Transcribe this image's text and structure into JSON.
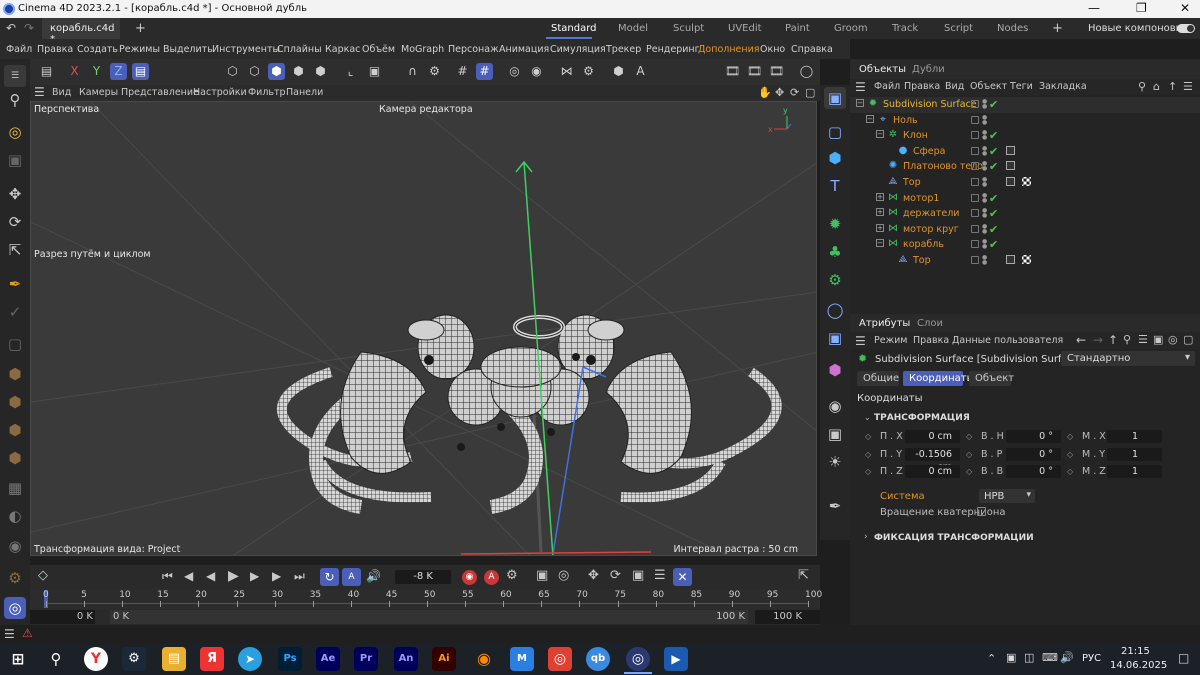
{
  "window": {
    "title": "Cinema 4D 2023.2.1 - [корабль.c4d *] - Основной дубль"
  },
  "doc_tab": {
    "label": "корабль.c4d *",
    "add": "+"
  },
  "layouts": {
    "items": [
      "Standard",
      "Model",
      "Sculpt",
      "UVEdit",
      "Paint",
      "Groom",
      "Track",
      "Script",
      "Nodes"
    ],
    "add": "+",
    "new_layouts": "Новые компоновки"
  },
  "menu": [
    "Файл",
    "Правка",
    "Создать",
    "Режимы",
    "Выделить",
    "Инструменты",
    "Сплайны",
    "Каркас",
    "Объём",
    "MoGraph",
    "Персонаж",
    "Анимация",
    "Симуляция",
    "Трекер",
    "Рендеринг",
    "Дополнения",
    "Окно",
    "Справка"
  ],
  "viewport_menu": [
    "Вид",
    "Камеры",
    "Представление",
    "Настройки",
    "Фильтр",
    "Панели"
  ],
  "viewport": {
    "label": "Перспектива",
    "camera": "Камера редактора",
    "slice_tool": "Разрез путём и циклом",
    "transform_info": "Трансформация вида: Project",
    "grid_info": "Интервал растра : 50 cm"
  },
  "axis_colors": {
    "x": "#e04040",
    "y": "#40d060",
    "z": "#4070e0"
  },
  "objects_panel": {
    "tabs": [
      "Объекты",
      "Дубли"
    ],
    "menu": [
      "Файл",
      "Правка",
      "Вид",
      "Объект",
      "Теги",
      "Закладка"
    ],
    "items": [
      {
        "name": "Subdivision Surface",
        "icon": "subdivision-icon",
        "color": "#e8b830",
        "check": "✔"
      },
      {
        "name": "Ноль",
        "icon": "null-icon",
        "color": "#e1942a",
        "check": ""
      },
      {
        "name": "Клон",
        "icon": "cloner-icon",
        "color": "#e1942a",
        "check": "✔"
      },
      {
        "name": "Сфера",
        "icon": "sphere-icon",
        "color": "#e1942a",
        "check": "✔"
      },
      {
        "name": "Платоново тело",
        "icon": "platonic-icon",
        "color": "#e1942a",
        "check": "✔"
      },
      {
        "name": "Тор",
        "icon": "torus-icon",
        "color": "#e1942a",
        "check": ""
      },
      {
        "name": "мотор1",
        "icon": "symmetry-icon",
        "color": "#e1942a",
        "check": "✔"
      },
      {
        "name": "держатели",
        "icon": "symmetry-icon",
        "color": "#e1942a",
        "check": "✔"
      },
      {
        "name": "мотор круг",
        "icon": "symmetry-icon",
        "color": "#e1942a",
        "check": "✔"
      },
      {
        "name": "корабль",
        "icon": "symmetry-icon",
        "color": "#e1942a",
        "check": "✔"
      },
      {
        "name": "Тор",
        "icon": "torus-icon",
        "color": "#e1942a",
        "check": ""
      }
    ]
  },
  "attributes_panel": {
    "tabs": [
      "Атрибуты",
      "Слои"
    ],
    "menu": [
      "Режим",
      "Правка",
      "Данные пользователя"
    ],
    "object_title": "Subdivision Surface [Subdivision Surface]",
    "preset": "Стандартно",
    "subtabs": [
      "Общие",
      "Координаты",
      "Объект"
    ],
    "section": "Координаты",
    "group_transform": "ТРАНСФОРМАЦИЯ",
    "pos_labels": [
      "П . X",
      "П . Y",
      "П . Z"
    ],
    "pos_values": [
      "0 cm",
      "-0.1506 cm",
      "0 cm"
    ],
    "rot_labels": [
      "В . Н",
      "В . Р",
      "В . В"
    ],
    "rot_values": [
      "0 °",
      "0 °",
      "0 °"
    ],
    "scale_labels": [
      "М . X",
      "М . Y",
      "М . Z"
    ],
    "scale_values": [
      "1",
      "1",
      "1"
    ],
    "system_label": "Система",
    "system_value": "НРВ",
    "quat_label": "Вращение кватерниона",
    "group_freeze": "ФИКСАЦИЯ ТРАНСФОРМАЦИИ"
  },
  "timeline": {
    "current_frame": "-8 K",
    "ruler": [
      "0",
      "5",
      "10",
      "15",
      "20",
      "25",
      "30",
      "35",
      "40",
      "45",
      "50",
      "55",
      "60",
      "65",
      "70",
      "75",
      "80",
      "85",
      "90",
      "95",
      "100"
    ],
    "start_min": "0 K",
    "start": "0 K",
    "end": "100 K",
    "end_max": "100 K"
  },
  "taskbar": {
    "apps": [
      "Ps",
      "Ae",
      "Pr",
      "An",
      "Ai"
    ],
    "lang": "РУС",
    "time": "21:15",
    "date": "14.06.2025"
  }
}
